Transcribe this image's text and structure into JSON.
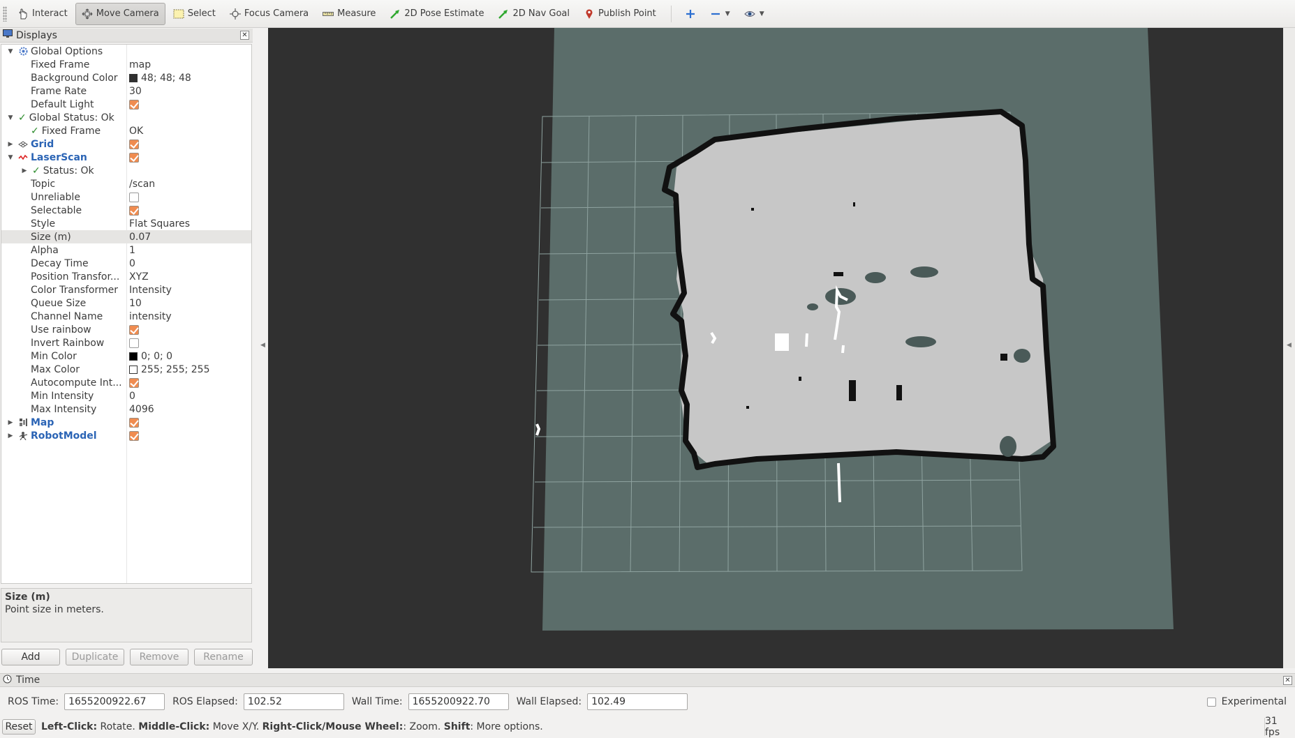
{
  "toolbar": {
    "interact": "Interact",
    "move_camera": "Move Camera",
    "select": "Select",
    "focus_camera": "Focus Camera",
    "measure": "Measure",
    "pose_estimate": "2D Pose Estimate",
    "nav_goal": "2D Nav Goal",
    "publish_point": "Publish Point"
  },
  "displays": {
    "title": "Displays",
    "rows": [
      {
        "name": "Global Options",
        "value": ""
      },
      {
        "name": "Fixed Frame",
        "value": "map"
      },
      {
        "name": "Background Color",
        "value": "48; 48; 48"
      },
      {
        "name": "Frame Rate",
        "value": "30"
      },
      {
        "name": "Default Light",
        "value": ""
      },
      {
        "name": "Global Status: Ok",
        "value": ""
      },
      {
        "name": "Fixed Frame",
        "value": "OK"
      },
      {
        "name": "Grid",
        "value": ""
      },
      {
        "name": "LaserScan",
        "value": ""
      },
      {
        "name": "Status: Ok",
        "value": ""
      },
      {
        "name": "Topic",
        "value": "/scan"
      },
      {
        "name": "Unreliable",
        "value": ""
      },
      {
        "name": "Selectable",
        "value": ""
      },
      {
        "name": "Style",
        "value": "Flat Squares"
      },
      {
        "name": "Size (m)",
        "value": "0.07"
      },
      {
        "name": "Alpha",
        "value": "1"
      },
      {
        "name": "Decay Time",
        "value": "0"
      },
      {
        "name": "Position Transfor...",
        "value": "XYZ"
      },
      {
        "name": "Color Transformer",
        "value": "Intensity"
      },
      {
        "name": "Queue Size",
        "value": "10"
      },
      {
        "name": "Channel Name",
        "value": "intensity"
      },
      {
        "name": "Use rainbow",
        "value": ""
      },
      {
        "name": "Invert Rainbow",
        "value": ""
      },
      {
        "name": "Min Color",
        "value": "0; 0; 0"
      },
      {
        "name": "Max Color",
        "value": "255; 255; 255"
      },
      {
        "name": "Autocompute Int...",
        "value": ""
      },
      {
        "name": "Min Intensity",
        "value": "0"
      },
      {
        "name": "Max Intensity",
        "value": "4096"
      },
      {
        "name": "Map",
        "value": ""
      },
      {
        "name": "RobotModel",
        "value": ""
      }
    ],
    "description_title": "Size (m)",
    "description_text": "Point size in meters.",
    "buttons": {
      "add": "Add",
      "duplicate": "Duplicate",
      "remove": "Remove",
      "rename": "Rename"
    }
  },
  "colors": {
    "background": "#303030",
    "min_color": "#000000",
    "max_color": "#ffffff",
    "accent_checkbox": "#f08c50"
  },
  "time": {
    "title": "Time",
    "ros_time_label": "ROS Time:",
    "ros_time": "1655200922.67",
    "ros_elapsed_label": "ROS Elapsed:",
    "ros_elapsed": "102.52",
    "wall_time_label": "Wall Time:",
    "wall_time": "1655200922.70",
    "wall_elapsed_label": "Wall Elapsed:",
    "wall_elapsed": "102.49",
    "experimental": "Experimental"
  },
  "status": {
    "reset": "Reset",
    "left_click": "Left-Click:",
    "left_click_desc": " Rotate. ",
    "middle_click": "Middle-Click:",
    "middle_click_desc": " Move X/Y. ",
    "right_click": "Right-Click/Mouse Wheel:",
    "right_click_desc": ": Zoom. ",
    "shift": "Shift",
    "shift_desc": ": More options.",
    "fps": "31 fps"
  }
}
